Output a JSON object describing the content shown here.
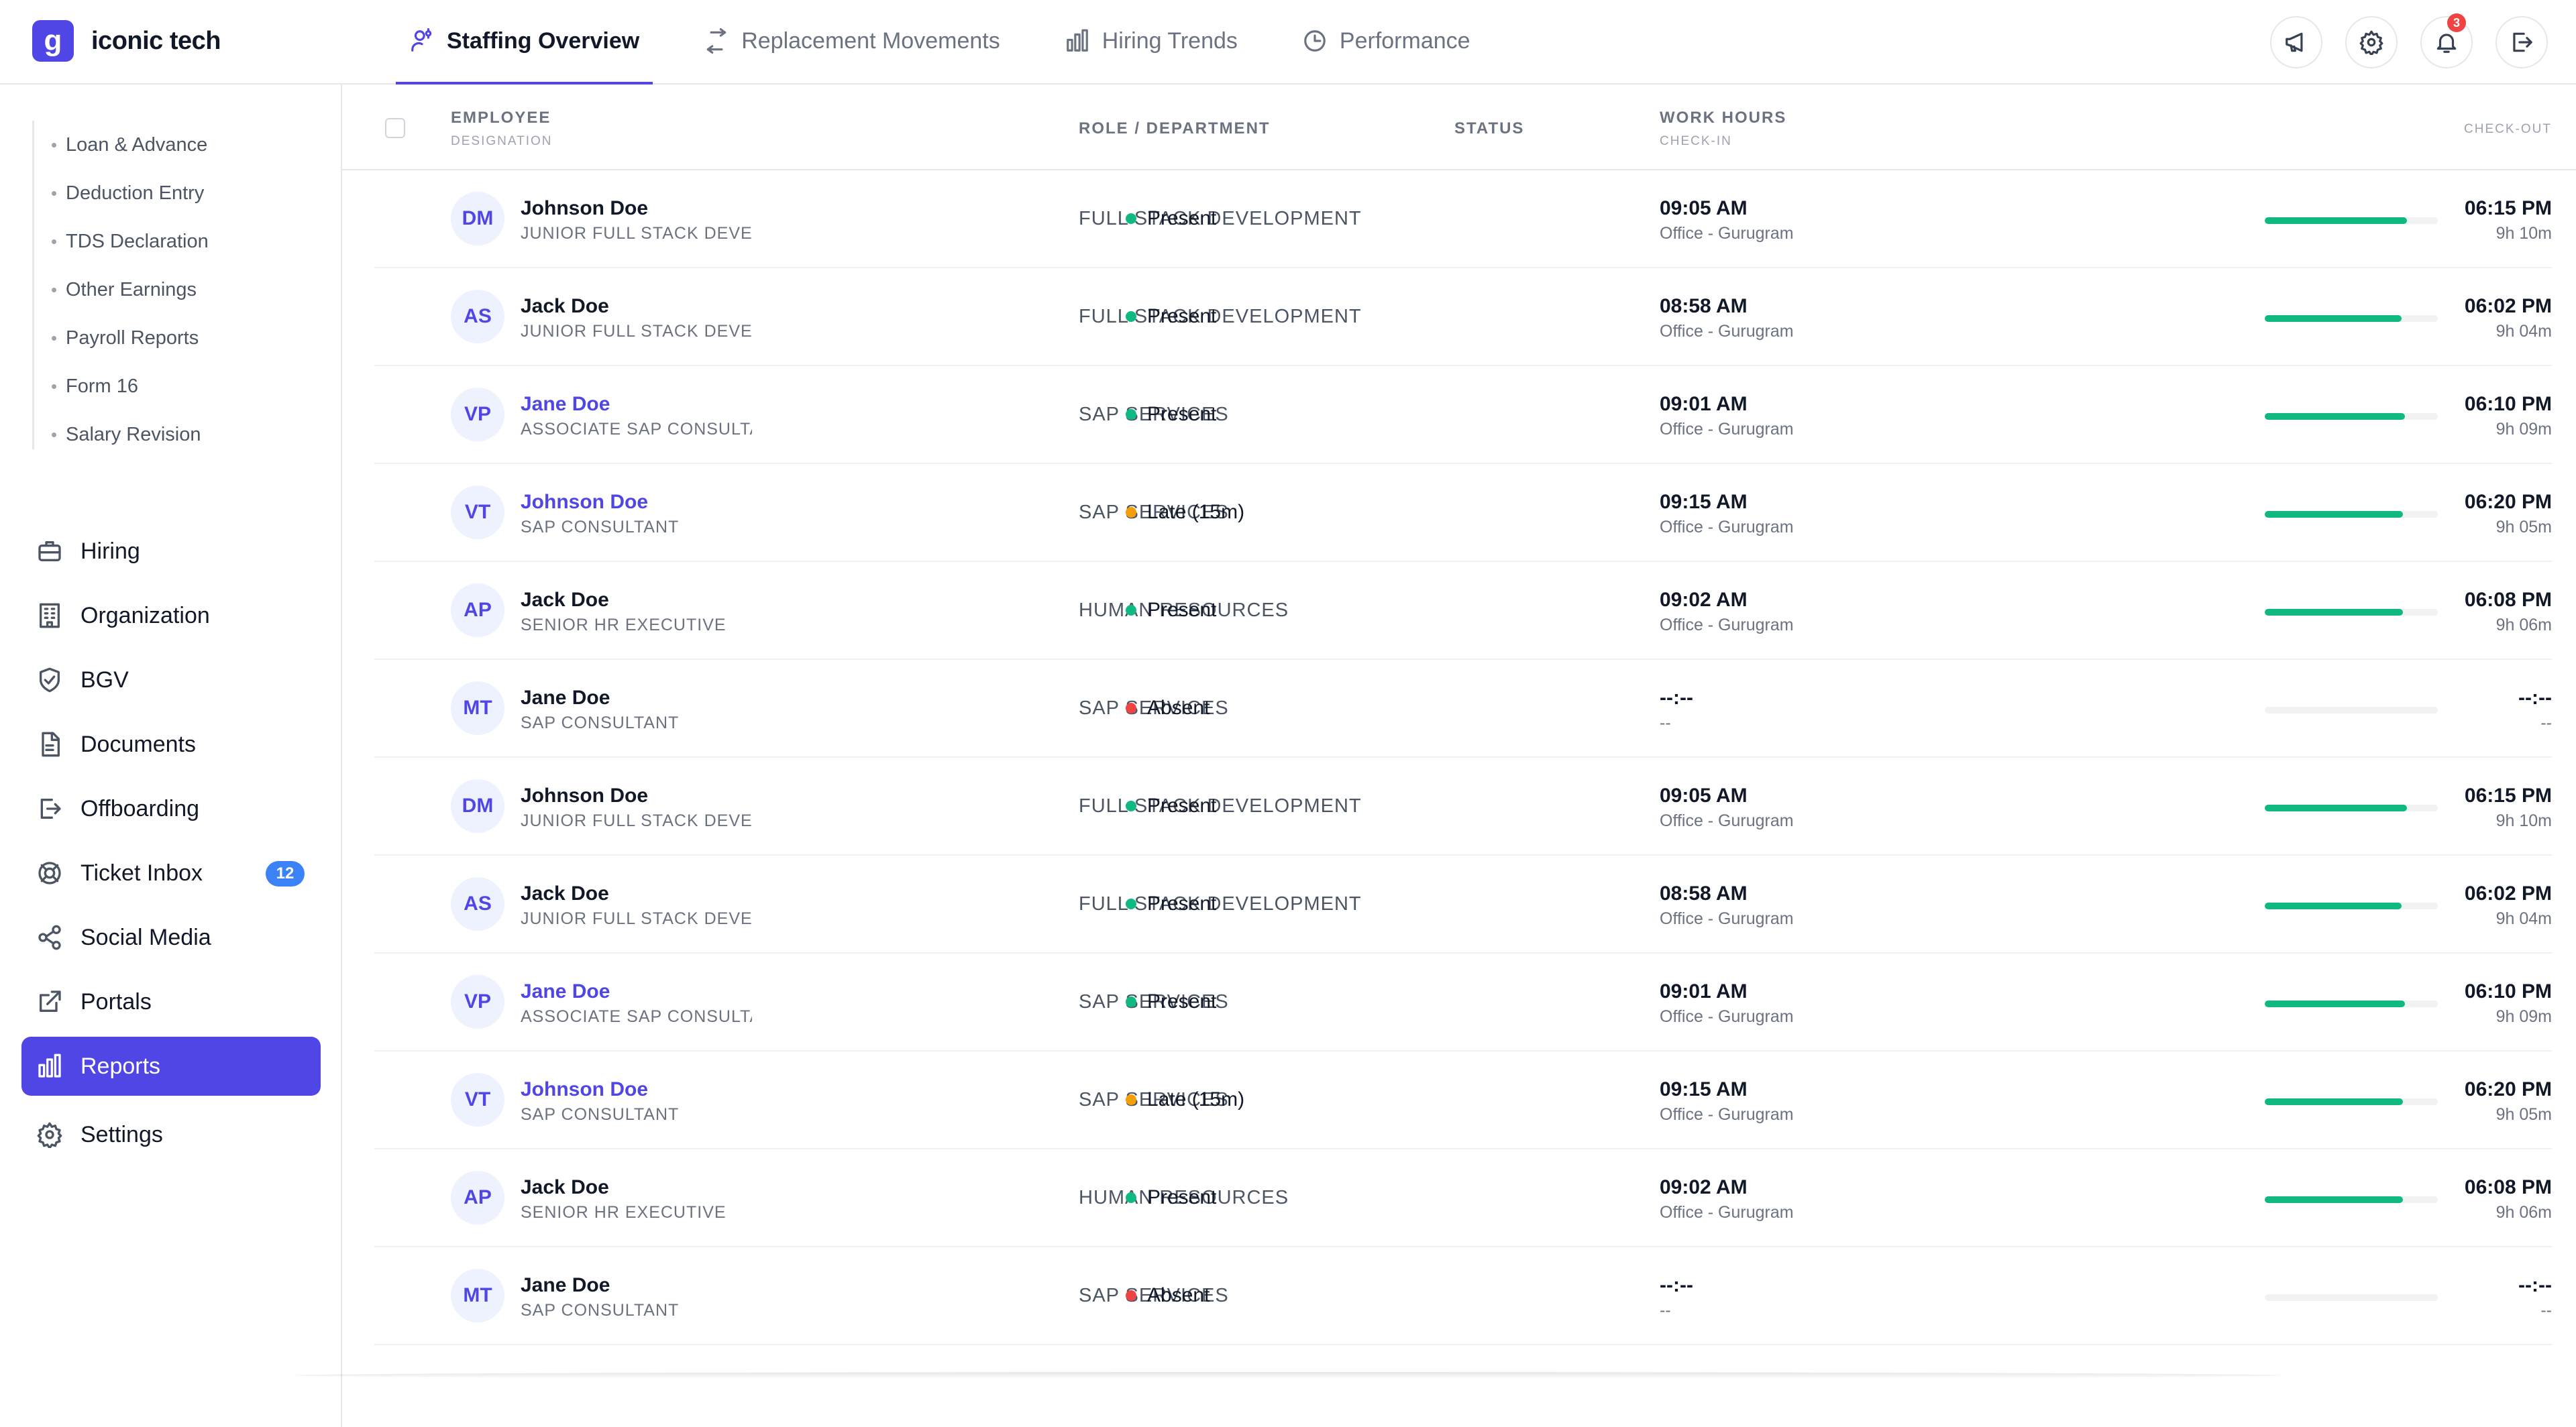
{
  "brand": {
    "logo_letter": "g",
    "name": "iconic tech",
    "accent": "#4f46e5"
  },
  "tabs": [
    {
      "label": "Staffing Overview",
      "icon": "user-cog-icon",
      "active": true
    },
    {
      "label": "Replacement Movements",
      "icon": "swap-arrows-icon",
      "active": false
    },
    {
      "label": "Hiring Trends",
      "icon": "bar-chart-icon",
      "active": false
    },
    {
      "label": "Performance",
      "icon": "clock-pie-icon",
      "active": false
    }
  ],
  "header_actions": {
    "announcements_icon": "megaphone-icon",
    "settings_icon": "gear-icon",
    "notifications_icon": "bell-icon",
    "notifications_count": "3",
    "logout_icon": "logout-icon"
  },
  "sidebar": {
    "sub_items": [
      "Loan & Advance",
      "Deduction Entry",
      "TDS Declaration",
      "Other Earnings",
      "Payroll Reports",
      "Form 16",
      "Salary Revision"
    ],
    "nav": [
      {
        "label": "Hiring",
        "icon": "briefcase-icon"
      },
      {
        "label": "Organization",
        "icon": "building-icon"
      },
      {
        "label": "BGV",
        "icon": "shield-check-icon"
      },
      {
        "label": "Documents",
        "icon": "document-icon"
      },
      {
        "label": "Offboarding",
        "icon": "exit-icon"
      },
      {
        "label": "Ticket Inbox",
        "icon": "lifebuoy-icon",
        "badge": "12"
      },
      {
        "label": "Social Media",
        "icon": "share-icon"
      },
      {
        "label": "Portals",
        "icon": "external-link-icon"
      },
      {
        "label": "Reports",
        "icon": "bar-chart-icon",
        "active": true
      },
      {
        "label": "Settings",
        "icon": "gear-icon"
      }
    ]
  },
  "table": {
    "headers": {
      "employee": "EMPLOYEE",
      "designation": "DESIGNATION",
      "role": "ROLE / DEPARTMENT",
      "status": "STATUS",
      "work_hours": "WORK HOURS",
      "check_in": "CHECK-IN",
      "check_out": "CHECK-OUT"
    },
    "status_colors": {
      "present": "#10b981",
      "late": "#f59e0b",
      "absent": "#ef4444"
    },
    "rows": [
      {
        "initials": "DM",
        "name": "Johnson Doe",
        "link": false,
        "designation": "JUNIOR FULL STACK DEVELOPER",
        "department": "FULL STACK DEVELOPMENT",
        "status": "Present",
        "status_type": "present",
        "check_in": "09:05 AM",
        "location": "Office - Gurugram",
        "check_out": "06:15 PM",
        "duration": "9h 10m",
        "progress": 0.82
      },
      {
        "initials": "AS",
        "name": "Jack Doe",
        "link": false,
        "designation": "JUNIOR FULL STACK DEVELOPER",
        "department": "FULL STACK DEVELOPMENT",
        "status": "Present",
        "status_type": "present",
        "check_in": "08:58 AM",
        "location": "Office - Gurugram",
        "check_out": "06:02 PM",
        "duration": "9h 04m",
        "progress": 0.79
      },
      {
        "initials": "VP",
        "name": "Jane Doe",
        "link": true,
        "designation": "ASSOCIATE SAP CONSULTANT",
        "department": "SAP SERVICES",
        "status": "Present",
        "status_type": "present",
        "check_in": "09:01 AM",
        "location": "Office - Gurugram",
        "check_out": "06:10 PM",
        "duration": "9h 09m",
        "progress": 0.81
      },
      {
        "initials": "VT",
        "name": "Johnson Doe",
        "link": true,
        "designation": "SAP CONSULTANT",
        "department": "SAP SERVICES",
        "status": "Late (15m)",
        "status_type": "late",
        "check_in": "09:15 AM",
        "location": "Office - Gurugram",
        "check_out": "06:20 PM",
        "duration": "9h 05m",
        "progress": 0.8
      },
      {
        "initials": "AP",
        "name": "Jack Doe",
        "link": false,
        "designation": "SENIOR HR EXECUTIVE",
        "department": "HUMAN RESOURCES",
        "status": "Present",
        "status_type": "present",
        "check_in": "09:02 AM",
        "location": "Office - Gurugram",
        "check_out": "06:08 PM",
        "duration": "9h 06m",
        "progress": 0.8
      },
      {
        "initials": "MT",
        "name": "Jane Doe",
        "link": false,
        "designation": "SAP CONSULTANT",
        "department": "SAP SERVICES",
        "status": "Absent",
        "status_type": "absent",
        "check_in": "--:--",
        "location": "--",
        "check_out": "--:--",
        "duration": "--",
        "progress": 0
      },
      {
        "initials": "DM",
        "name": "Johnson Doe",
        "link": false,
        "designation": "JUNIOR FULL STACK DEVELOPER",
        "department": "FULL STACK DEVELOPMENT",
        "status": "Present",
        "status_type": "present",
        "check_in": "09:05 AM",
        "location": "Office - Gurugram",
        "check_out": "06:15 PM",
        "duration": "9h 10m",
        "progress": 0.82
      },
      {
        "initials": "AS",
        "name": "Jack Doe",
        "link": false,
        "designation": "JUNIOR FULL STACK DEVELOPER",
        "department": "FULL STACK DEVELOPMENT",
        "status": "Present",
        "status_type": "present",
        "check_in": "08:58 AM",
        "location": "Office - Gurugram",
        "check_out": "06:02 PM",
        "duration": "9h 04m",
        "progress": 0.79
      },
      {
        "initials": "VP",
        "name": "Jane Doe",
        "link": true,
        "designation": "ASSOCIATE SAP CONSULTANT",
        "department": "SAP SERVICES",
        "status": "Present",
        "status_type": "present",
        "check_in": "09:01 AM",
        "location": "Office - Gurugram",
        "check_out": "06:10 PM",
        "duration": "9h 09m",
        "progress": 0.81
      },
      {
        "initials": "VT",
        "name": "Johnson Doe",
        "link": true,
        "designation": "SAP CONSULTANT",
        "department": "SAP SERVICES",
        "status": "Late (15m)",
        "status_type": "late",
        "check_in": "09:15 AM",
        "location": "Office - Gurugram",
        "check_out": "06:20 PM",
        "duration": "9h 05m",
        "progress": 0.8
      },
      {
        "initials": "AP",
        "name": "Jack Doe",
        "link": false,
        "designation": "SENIOR HR EXECUTIVE",
        "department": "HUMAN RESOURCES",
        "status": "Present",
        "status_type": "present",
        "check_in": "09:02 AM",
        "location": "Office - Gurugram",
        "check_out": "06:08 PM",
        "duration": "9h 06m",
        "progress": 0.8
      },
      {
        "initials": "MT",
        "name": "Jane Doe",
        "link": false,
        "designation": "SAP CONSULTANT",
        "department": "SAP SERVICES",
        "status": "Absent",
        "status_type": "absent",
        "check_in": "--:--",
        "location": "--",
        "check_out": "--:--",
        "duration": "--",
        "progress": 0
      }
    ]
  }
}
